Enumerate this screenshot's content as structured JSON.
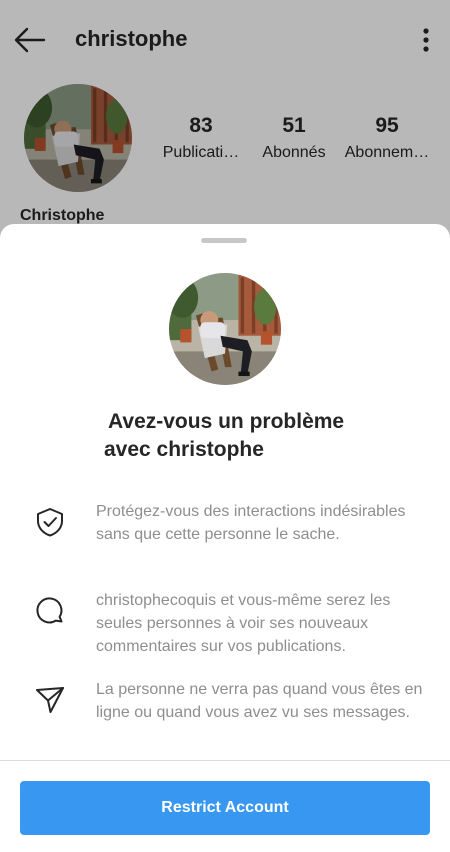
{
  "header": {
    "username": "christophe"
  },
  "profile": {
    "display_name": "Christophe",
    "stats": [
      {
        "value": "83",
        "label": "Publicati…"
      },
      {
        "value": "51",
        "label": "Abonnés"
      },
      {
        "value": "95",
        "label": "Abonnem…"
      }
    ]
  },
  "sheet": {
    "title_line1": "Avez-vous un problème",
    "title_line2": "avec christophe",
    "items": [
      {
        "icon": "shield-check-icon",
        "text": "Protégez-vous des interactions indésirables sans que cette personne le sache."
      },
      {
        "icon": "comment-bubble-icon",
        "text": "christophecoquis et vous-même serez les seules personnes à voir ses nouveaux commentaires sur vos publications."
      },
      {
        "icon": "paper-plane-icon",
        "text": "La personne ne verra pas quand vous êtes en ligne ou quand vous avez vu ses messages."
      }
    ],
    "button_label": "Restrict Account"
  },
  "colors": {
    "accent": "#3897f0",
    "text_primary": "#262626",
    "text_secondary": "#8e8e8e"
  }
}
